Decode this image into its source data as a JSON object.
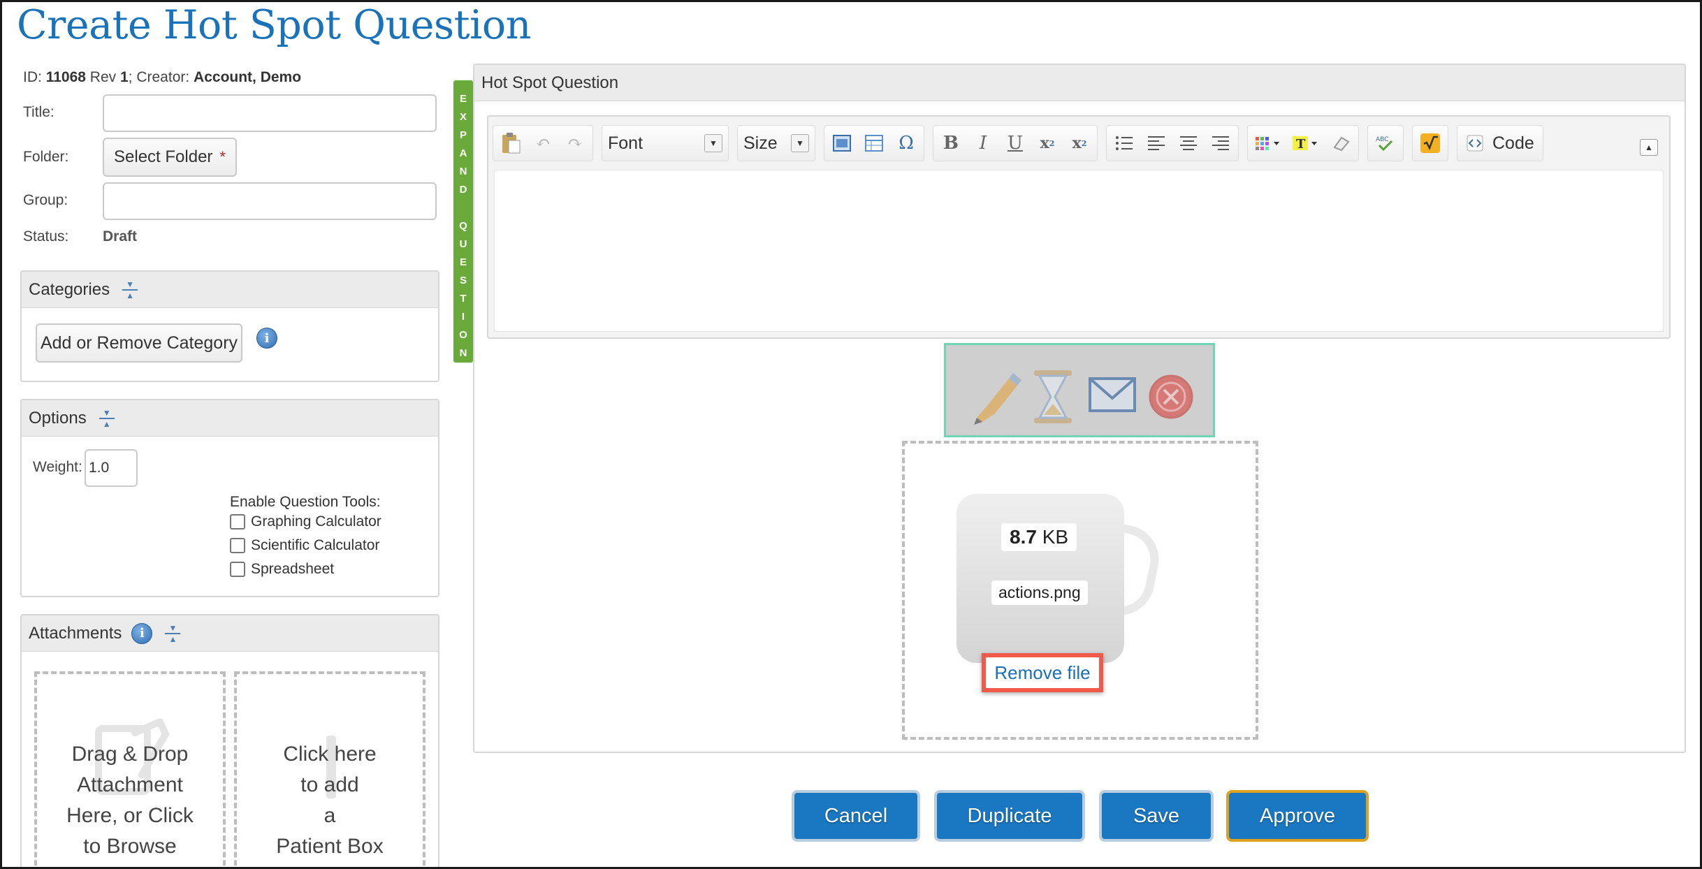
{
  "page": {
    "title": "Create Hot Spot Question"
  },
  "meta": {
    "id_label": "ID:",
    "id_value": "11068",
    "rev_label": "Rev",
    "rev_value": "1",
    "creator_label": "; Creator:",
    "creator_value": "Account, Demo"
  },
  "form": {
    "title_label": "Title:",
    "title_value": "",
    "folder_label": "Folder:",
    "folder_button": "Select Folder",
    "required_mark": "*",
    "group_label": "Group:",
    "group_value": "",
    "status_label": "Status:",
    "status_value": "Draft"
  },
  "categories": {
    "title": "Categories",
    "add_button": "Add or Remove Category"
  },
  "options": {
    "title": "Options",
    "weight_label": "Weight:",
    "weight_value": "1.0",
    "tools_label": "Enable Question Tools:",
    "tools": [
      {
        "label": "Graphing Calculator",
        "checked": false
      },
      {
        "label": "Scientific Calculator",
        "checked": false
      },
      {
        "label": "Spreadsheet",
        "checked": false
      }
    ]
  },
  "attachments": {
    "title": "Attachments",
    "drop_lines": [
      "Drag & Drop",
      "Attachment",
      "Here, or Click",
      "to Browse"
    ],
    "patient_lines": [
      "Click here",
      "to add",
      "a",
      "Patient Box"
    ]
  },
  "expand_tab": {
    "letters": [
      "E",
      "X",
      "P",
      "A",
      "N",
      "D",
      "",
      "Q",
      "U",
      "E",
      "S",
      "T",
      "I",
      "O",
      "N"
    ]
  },
  "question": {
    "title": "Hot Spot Question",
    "toolbar": {
      "font_label": "Font",
      "size_label": "Size",
      "code_label": "Code"
    },
    "image_icons": [
      "pencil-icon",
      "hourglass-icon",
      "envelope-icon",
      "stop-icon"
    ],
    "file": {
      "size_number": "8.7",
      "size_unit": "KB",
      "name": "actions.png",
      "remove_label": "Remove file"
    }
  },
  "actions": {
    "cancel": "Cancel",
    "duplicate": "Duplicate",
    "save": "Save",
    "approve": "Approve"
  },
  "colors": {
    "accent": "#1a78c2",
    "title": "#1a73b8",
    "expand_tab": "#6aaa3a",
    "highlight": "#ef5a4a",
    "image_border": "#6ed6b4",
    "approve_border": "#e0a020"
  }
}
